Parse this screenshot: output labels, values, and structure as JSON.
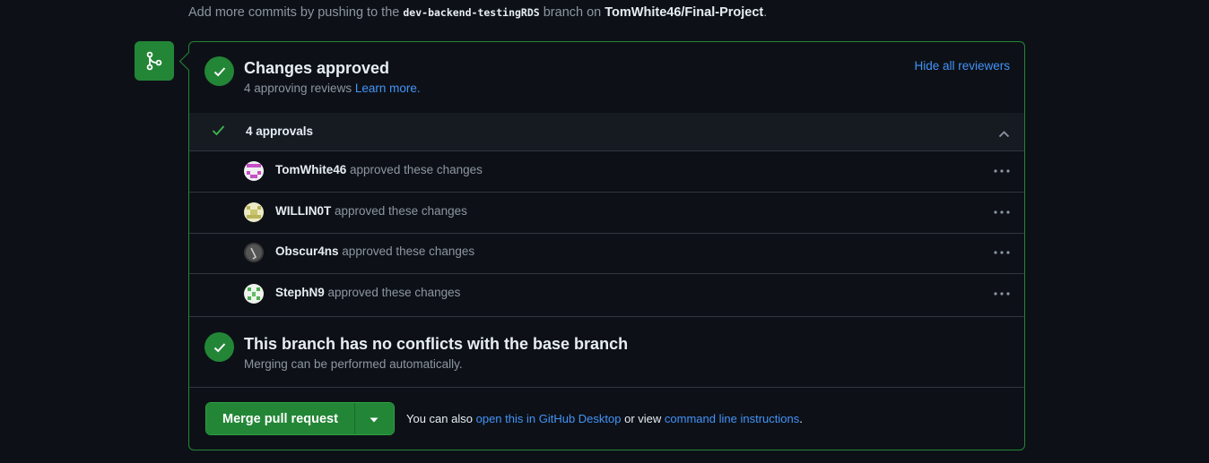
{
  "top_note": {
    "prefix": "Add more commits by pushing to the",
    "branch": "dev-backend-testingRDS",
    "middle": "branch on",
    "repo": "TomWhite46/Final-Project",
    "suffix": "."
  },
  "approval": {
    "title": "Changes approved",
    "subtitle": "4 approving reviews",
    "learn_more": "Learn more.",
    "hide_reviewers": "Hide all reviewers",
    "approvals_label": "4 approvals",
    "reviewers": [
      {
        "name": "TomWhite46",
        "action": "approved these changes"
      },
      {
        "name": "WILLIN0T",
        "action": "approved these changes"
      },
      {
        "name": "Obscur4ns",
        "action": "approved these changes"
      },
      {
        "name": "StephN9",
        "action": "approved these changes"
      }
    ]
  },
  "conflicts": {
    "title": "This branch has no conflicts with the base branch",
    "subtitle": "Merging can be performed automatically."
  },
  "merge": {
    "button_label": "Merge pull request",
    "note_prefix": "You can also",
    "desktop_link": "open this in GitHub Desktop",
    "note_middle": "or view",
    "cli_link": "command line instructions",
    "note_suffix": "."
  },
  "colors": {
    "background": "#0d1117",
    "accent_green": "#238636",
    "link_blue": "#4493f8",
    "muted_text": "#8d96a0"
  },
  "icons": {
    "merge_badge": "git-merge-icon",
    "status": "check-circle-icon",
    "approvals_check": "check-icon",
    "collapse": "chevron-up-icon",
    "row_menu": "kebab-horizontal-icon",
    "dropdown": "triangle-down-icon"
  }
}
